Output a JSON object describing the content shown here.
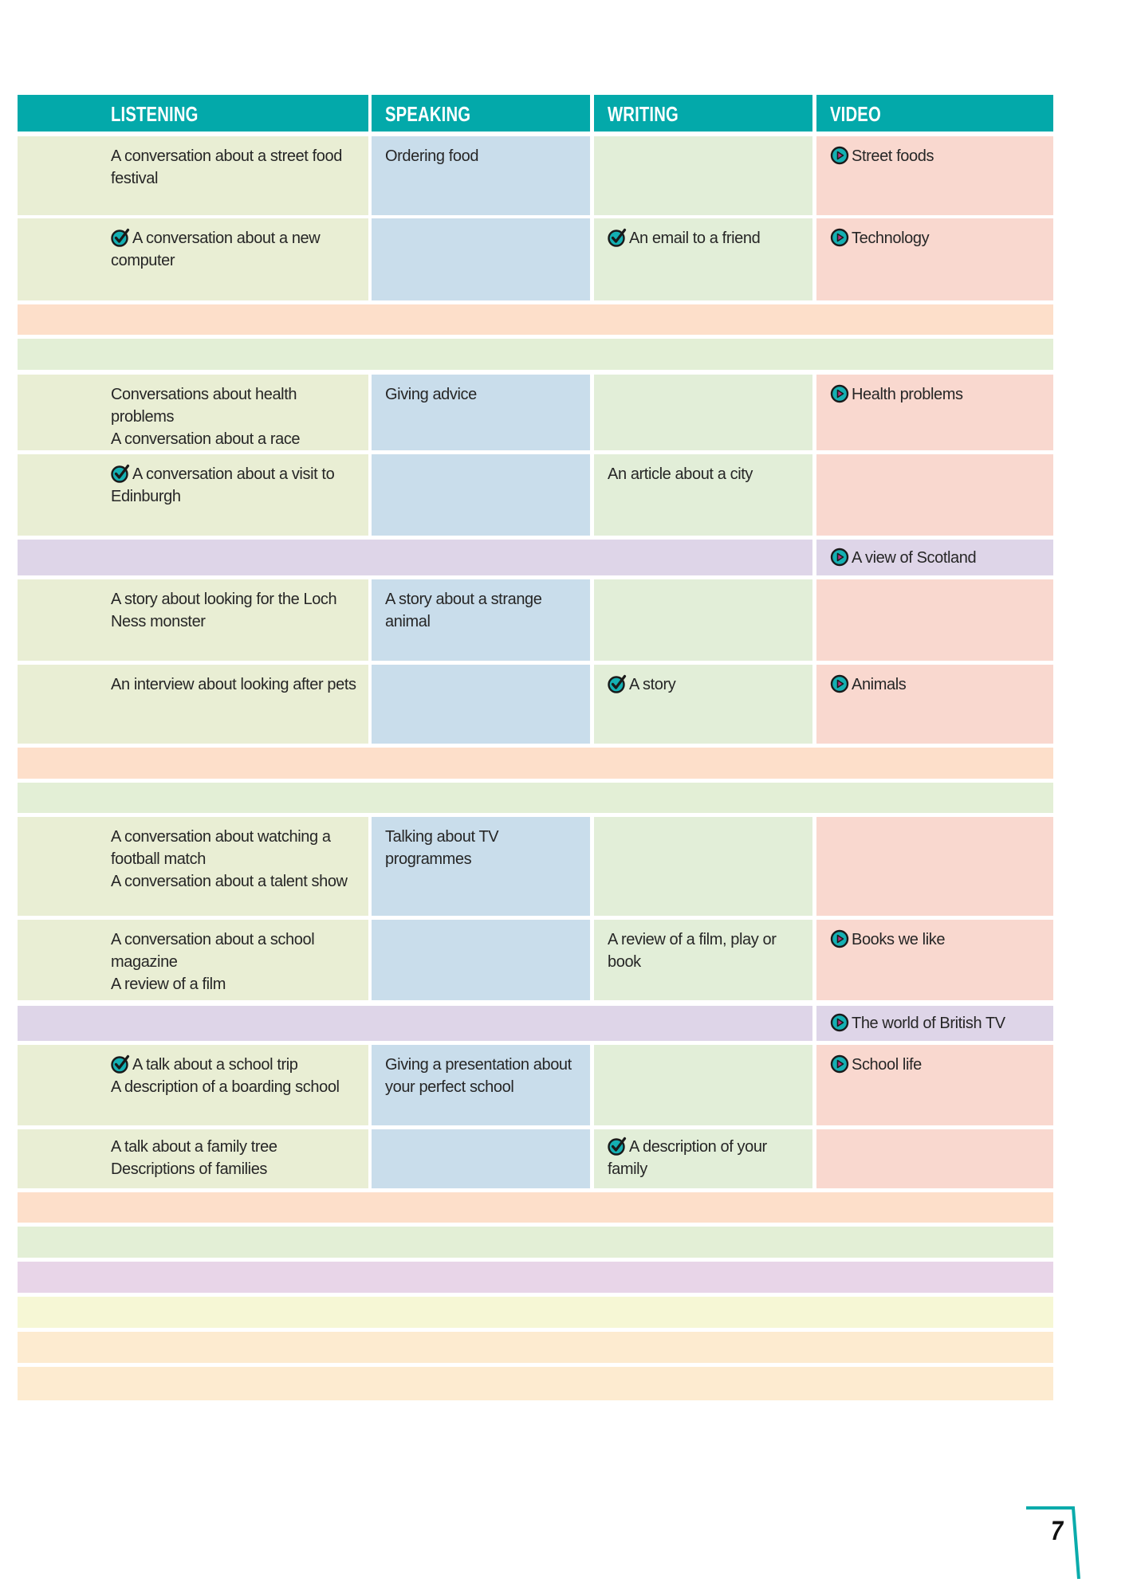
{
  "header": {
    "listening": "LISTENING",
    "speaking": "SPEAKING",
    "writing": "WRITING",
    "video": "VIDEO"
  },
  "icons": {
    "check": "check-circle-icon",
    "video": "play-circle-icon"
  },
  "colors": {
    "header_teal": "#03a9aa",
    "listening_cell": "#e9eed4",
    "speaking_cell": "#c9ddeb",
    "writing_cell": "#e2eed8",
    "video_cell": "#f9d8cf",
    "peach_band": "#fddfca",
    "green_band": "#e3efd6",
    "purple_band": "#ded5e8"
  },
  "rows": [
    {
      "listening": [
        "A conversation about a street food festival"
      ],
      "listening_check": false,
      "speaking": "Ordering food",
      "writing": "",
      "writing_check": false,
      "video": "Street foods"
    },
    {
      "listening": [
        "A conversation about a new computer"
      ],
      "listening_check": true,
      "speaking": "",
      "writing": "An email to a friend",
      "writing_check": true,
      "video": "Technology"
    },
    {
      "listening": [
        "Conversations about health problems",
        "A conversation about a race"
      ],
      "listening_check": false,
      "speaking": "Giving advice",
      "writing": "",
      "writing_check": false,
      "video": "Health problems"
    },
    {
      "listening": [
        "A conversation about a visit to Edinburgh"
      ],
      "listening_check": true,
      "speaking": "",
      "writing": "An article about a city",
      "writing_check": false,
      "video": ""
    },
    {
      "video": "A view of Scotland"
    },
    {
      "listening": [
        "A story about looking for the Loch Ness monster"
      ],
      "listening_check": false,
      "speaking": "A story about a strange animal",
      "writing": "",
      "writing_check": false,
      "video": ""
    },
    {
      "listening": [
        "An interview about looking after pets"
      ],
      "listening_check": false,
      "speaking": "",
      "writing": "A story",
      "writing_check": true,
      "video": "Animals"
    },
    {
      "listening": [
        "A conversation about watching a football match",
        "A conversation about a talent show"
      ],
      "listening_check": false,
      "speaking": "Talking about TV programmes",
      "writing": "",
      "writing_check": false,
      "video": ""
    },
    {
      "listening": [
        "A conversation about a school magazine",
        "A review of a film"
      ],
      "listening_check": false,
      "speaking": "",
      "writing": "A review of a film, play or book",
      "writing_check": false,
      "video": "Books we like"
    },
    {
      "video": "The world of British TV"
    },
    {
      "listening": [
        "A talk about a school trip",
        "A description of a boarding school"
      ],
      "listening_check": true,
      "speaking": "Giving a presentation about your perfect school",
      "writing": "",
      "writing_check": false,
      "video": "School life"
    },
    {
      "listening": [
        "A talk about a family tree",
        "Descriptions of families"
      ],
      "listening_check": false,
      "speaking": "",
      "writing": "A description of your family",
      "writing_check": true,
      "video": ""
    }
  ],
  "page_number": "7"
}
